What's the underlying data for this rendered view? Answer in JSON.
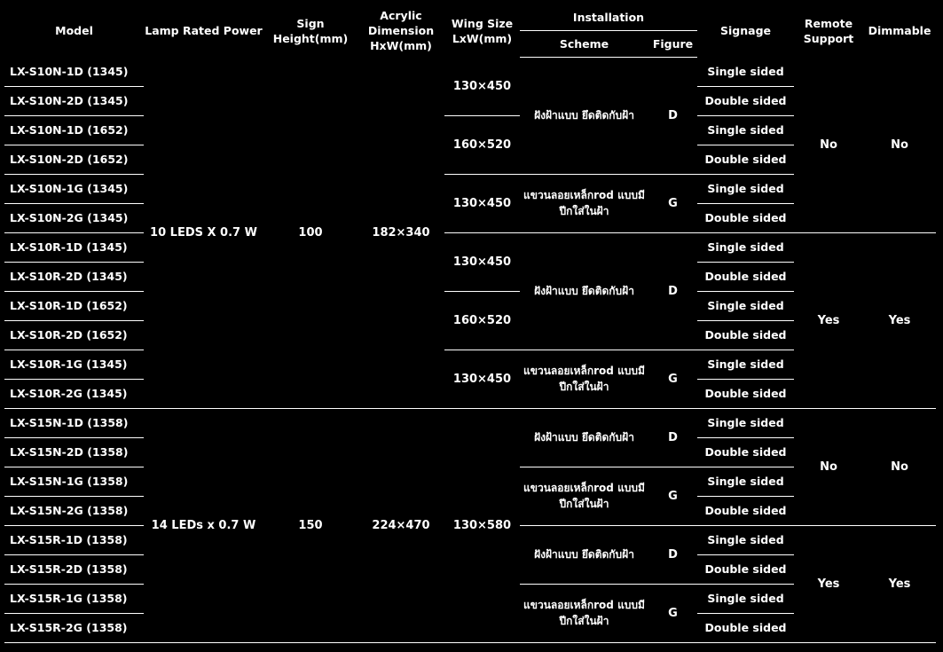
{
  "header": {
    "model": "Model",
    "lamp_power": "Lamp Rated Power",
    "sign_height": "Sign Height(mm)",
    "acrylic": "Acrylic Dimension HxW(mm)",
    "wing_size": "Wing Size LxW(mm)",
    "installation": "Installation",
    "scheme": "Scheme",
    "figure": "Figure",
    "signage": "Signage",
    "remote": "Remote Support",
    "dimmable": "Dimmable"
  },
  "groups": [
    {
      "power": "10 LEDS X 0.7 W",
      "height": "100",
      "acrylic": "182×340"
    },
    {
      "power": "14 LEDs x 0.7 W",
      "height": "150",
      "acrylic": "224×470",
      "wing": "130×580"
    }
  ],
  "wings": [
    "130×450",
    "160×520",
    "130×450",
    "130×450",
    "160×520",
    "130×450"
  ],
  "install": [
    {
      "scheme": "ฝังฝ้าแบบ ยึดติดกับฝ้า",
      "figure": "D"
    },
    {
      "scheme": "แขวนลอยเหล็กrod แบบมีปีกใส่ในฝ้า",
      "figure": "G"
    },
    {
      "scheme": "ฝังฝ้าแบบ ยึดติดกับฝ้า",
      "figure": "D"
    },
    {
      "scheme": "แขวนลอยเหล็กrod แบบมีปีกใส่ในฝ้า",
      "figure": "G"
    },
    {
      "scheme": "ฝังฝ้าแบบ ยึดติดกับฝ้า",
      "figure": "D"
    },
    {
      "scheme": "แขวนลอยเหล็กrod แบบมีปีกใส่ในฝ้า",
      "figure": "G"
    },
    {
      "scheme": "ฝังฝ้าแบบ ยึดติดกับฝ้า",
      "figure": "D"
    },
    {
      "scheme": "แขวนลอยเหล็กrod แบบมีปีกใส่ในฝ้า",
      "figure": "G"
    }
  ],
  "support": [
    {
      "remote": "No",
      "dimmable": "No"
    },
    {
      "remote": "Yes",
      "dimmable": "Yes"
    },
    {
      "remote": "No",
      "dimmable": "No"
    },
    {
      "remote": "Yes",
      "dimmable": "Yes"
    }
  ],
  "rows": [
    {
      "model": "LX-S10N-1D (1345)",
      "signage": "Single sided"
    },
    {
      "model": "LX-S10N-2D (1345)",
      "signage": "Double sided"
    },
    {
      "model": "LX-S10N-1D (1652)",
      "signage": "Single sided"
    },
    {
      "model": "LX-S10N-2D (1652)",
      "signage": "Double sided"
    },
    {
      "model": "LX-S10N-1G (1345)",
      "signage": "Single sided"
    },
    {
      "model": "LX-S10N-2G (1345)",
      "signage": "Double sided"
    },
    {
      "model": "LX-S10R-1D (1345)",
      "signage": "Single sided"
    },
    {
      "model": "LX-S10R-2D (1345)",
      "signage": "Double sided"
    },
    {
      "model": "LX-S10R-1D (1652)",
      "signage": "Single sided"
    },
    {
      "model": "LX-S10R-2D (1652)",
      "signage": "Double sided"
    },
    {
      "model": "LX-S10R-1G (1345)",
      "signage": "Single sided"
    },
    {
      "model": "LX-S10R-2G (1345)",
      "signage": "Double sided"
    },
    {
      "model": "LX-S15N-1D (1358)",
      "signage": "Single sided"
    },
    {
      "model": "LX-S15N-2D (1358)",
      "signage": "Double sided"
    },
    {
      "model": "LX-S15N-1G (1358)",
      "signage": "Single sided"
    },
    {
      "model": "LX-S15N-2G (1358)",
      "signage": "Double sided"
    },
    {
      "model": "LX-S15R-1D (1358)",
      "signage": "Single sided"
    },
    {
      "model": "LX-S15R-2D (1358)",
      "signage": "Double sided"
    },
    {
      "model": "LX-S15R-1G (1358)",
      "signage": "Single sided"
    },
    {
      "model": "LX-S15R-2G (1358)",
      "signage": "Double sided"
    }
  ]
}
